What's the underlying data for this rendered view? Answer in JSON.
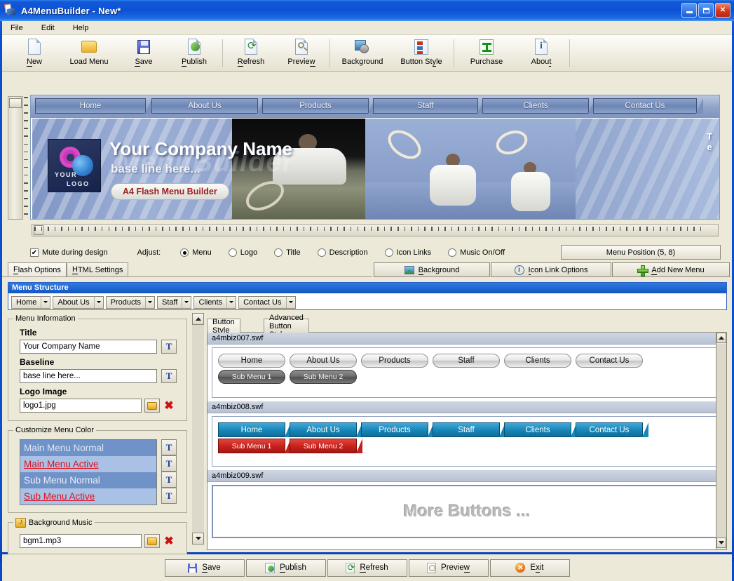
{
  "window": {
    "title": "A4MenuBuilder - New*",
    "minimize": "_",
    "maximize": "□",
    "close": "✕"
  },
  "menubar": [
    {
      "label": "File"
    },
    {
      "label": "Edit"
    },
    {
      "label": "Help"
    }
  ],
  "toolbar": [
    {
      "label": "New",
      "icon": "new-document-icon"
    },
    {
      "label": "Load Menu",
      "icon": "folder-open-icon"
    },
    {
      "label": "Save",
      "icon": "floppy-disk-icon"
    },
    {
      "label": "Publish",
      "icon": "publish-icon"
    },
    {
      "label": "Refresh",
      "icon": "refresh-icon"
    },
    {
      "label": "Preview",
      "icon": "magnifier-icon"
    },
    {
      "label": "Background",
      "icon": "background-image-icon"
    },
    {
      "label": "Button Style",
      "icon": "button-style-icon"
    },
    {
      "label": "Purchase",
      "icon": "cart-icon"
    },
    {
      "label": "About",
      "icon": "info-icon"
    }
  ],
  "preview": {
    "nav_items": [
      "Home",
      "About Us",
      "Products",
      "Staff",
      "Clients",
      "Contact Us"
    ],
    "banner": {
      "title": "Your Company Name",
      "baseline": "base line here...",
      "pill": "A4 Flash Menu Builder",
      "watermark": "MenuBuilder",
      "logo_line1": "YOUR",
      "logo_line2": "LOGO",
      "right_text": "T",
      "right_sub": "e"
    }
  },
  "options": {
    "mute_label": "Mute during design",
    "mute_checked": "✔",
    "adjust_label": "Adjust:",
    "radios": [
      {
        "label": "Menu",
        "selected": true
      },
      {
        "label": "Logo",
        "selected": false
      },
      {
        "label": "Title",
        "selected": false
      },
      {
        "label": "Description",
        "selected": false
      },
      {
        "label": "Icon Links",
        "selected": false
      },
      {
        "label": "Music On/Off",
        "selected": false
      }
    ],
    "menu_position": "Menu Position (5, 8)"
  },
  "panel_tabs": [
    {
      "label": "Flash Options",
      "active": true
    },
    {
      "label": "HTML Settings",
      "active": false
    }
  ],
  "action_buttons": [
    {
      "label": "Background",
      "icon": "background-image-icon"
    },
    {
      "label": "Icon Link Options",
      "icon": "info-circle-icon"
    },
    {
      "label": "Add New Menu",
      "icon": "green-plus-icon"
    }
  ],
  "menu_structure": {
    "header": "Menu Structure",
    "items": [
      "Home",
      "About Us",
      "Products",
      "Staff",
      "Clients",
      "Contact Us"
    ]
  },
  "menu_information": {
    "caption": "Menu Information",
    "title_label": "Title",
    "title_value": "Your Company Name",
    "baseline_label": "Baseline",
    "baseline_value": "base line here...",
    "logo_label": "Logo Image",
    "logo_value": "logo1.jpg",
    "font_button": "T"
  },
  "customize_menu_color": {
    "caption": "Customize Menu Color",
    "rows": [
      {
        "label": "Main Menu Normal"
      },
      {
        "label": "Main Menu Active"
      },
      {
        "label": "Sub Menu Normal"
      },
      {
        "label": "Sub Menu Active"
      }
    ]
  },
  "background_music": {
    "caption": "Background Music",
    "value": "bgm1.mp3"
  },
  "button_style": {
    "tabs": [
      {
        "label": "Button Style",
        "active": true
      },
      {
        "label": "Advanced Button Style",
        "active": false
      }
    ],
    "styles": [
      {
        "file": "a4mbiz007.swf",
        "main": [
          "Home",
          "About Us",
          "Products",
          "Staff",
          "Clients",
          "Contact Us"
        ],
        "sub": [
          "Sub Menu 1",
          "Sub Menu 2"
        ]
      },
      {
        "file": "a4mbiz008.swf",
        "main": [
          "Home",
          "About Us",
          "Products",
          "Staff",
          "Clients",
          "Contact Us"
        ],
        "sub": [
          "Sub Menu 1",
          "Sub Menu 2"
        ]
      },
      {
        "file": "a4mbiz009.swf",
        "placeholder": "More Buttons ..."
      }
    ]
  },
  "bottom_bar": [
    {
      "label": "Save",
      "icon": "floppy-disk-icon"
    },
    {
      "label": "Publish",
      "icon": "publish-icon"
    },
    {
      "label": "Refresh",
      "icon": "refresh-icon"
    },
    {
      "label": "Preview",
      "icon": "magnifier-icon"
    },
    {
      "label": "Exit",
      "icon": "exit-icon"
    }
  ],
  "colors": {
    "titlebar_blue": "#0d52d4",
    "panel_face": "#ece9d8",
    "accent_red": "#e01020",
    "nav_blue": "#7f95bf",
    "swf008_blue": "#1785b6",
    "swf008_red": "#c4211b"
  }
}
